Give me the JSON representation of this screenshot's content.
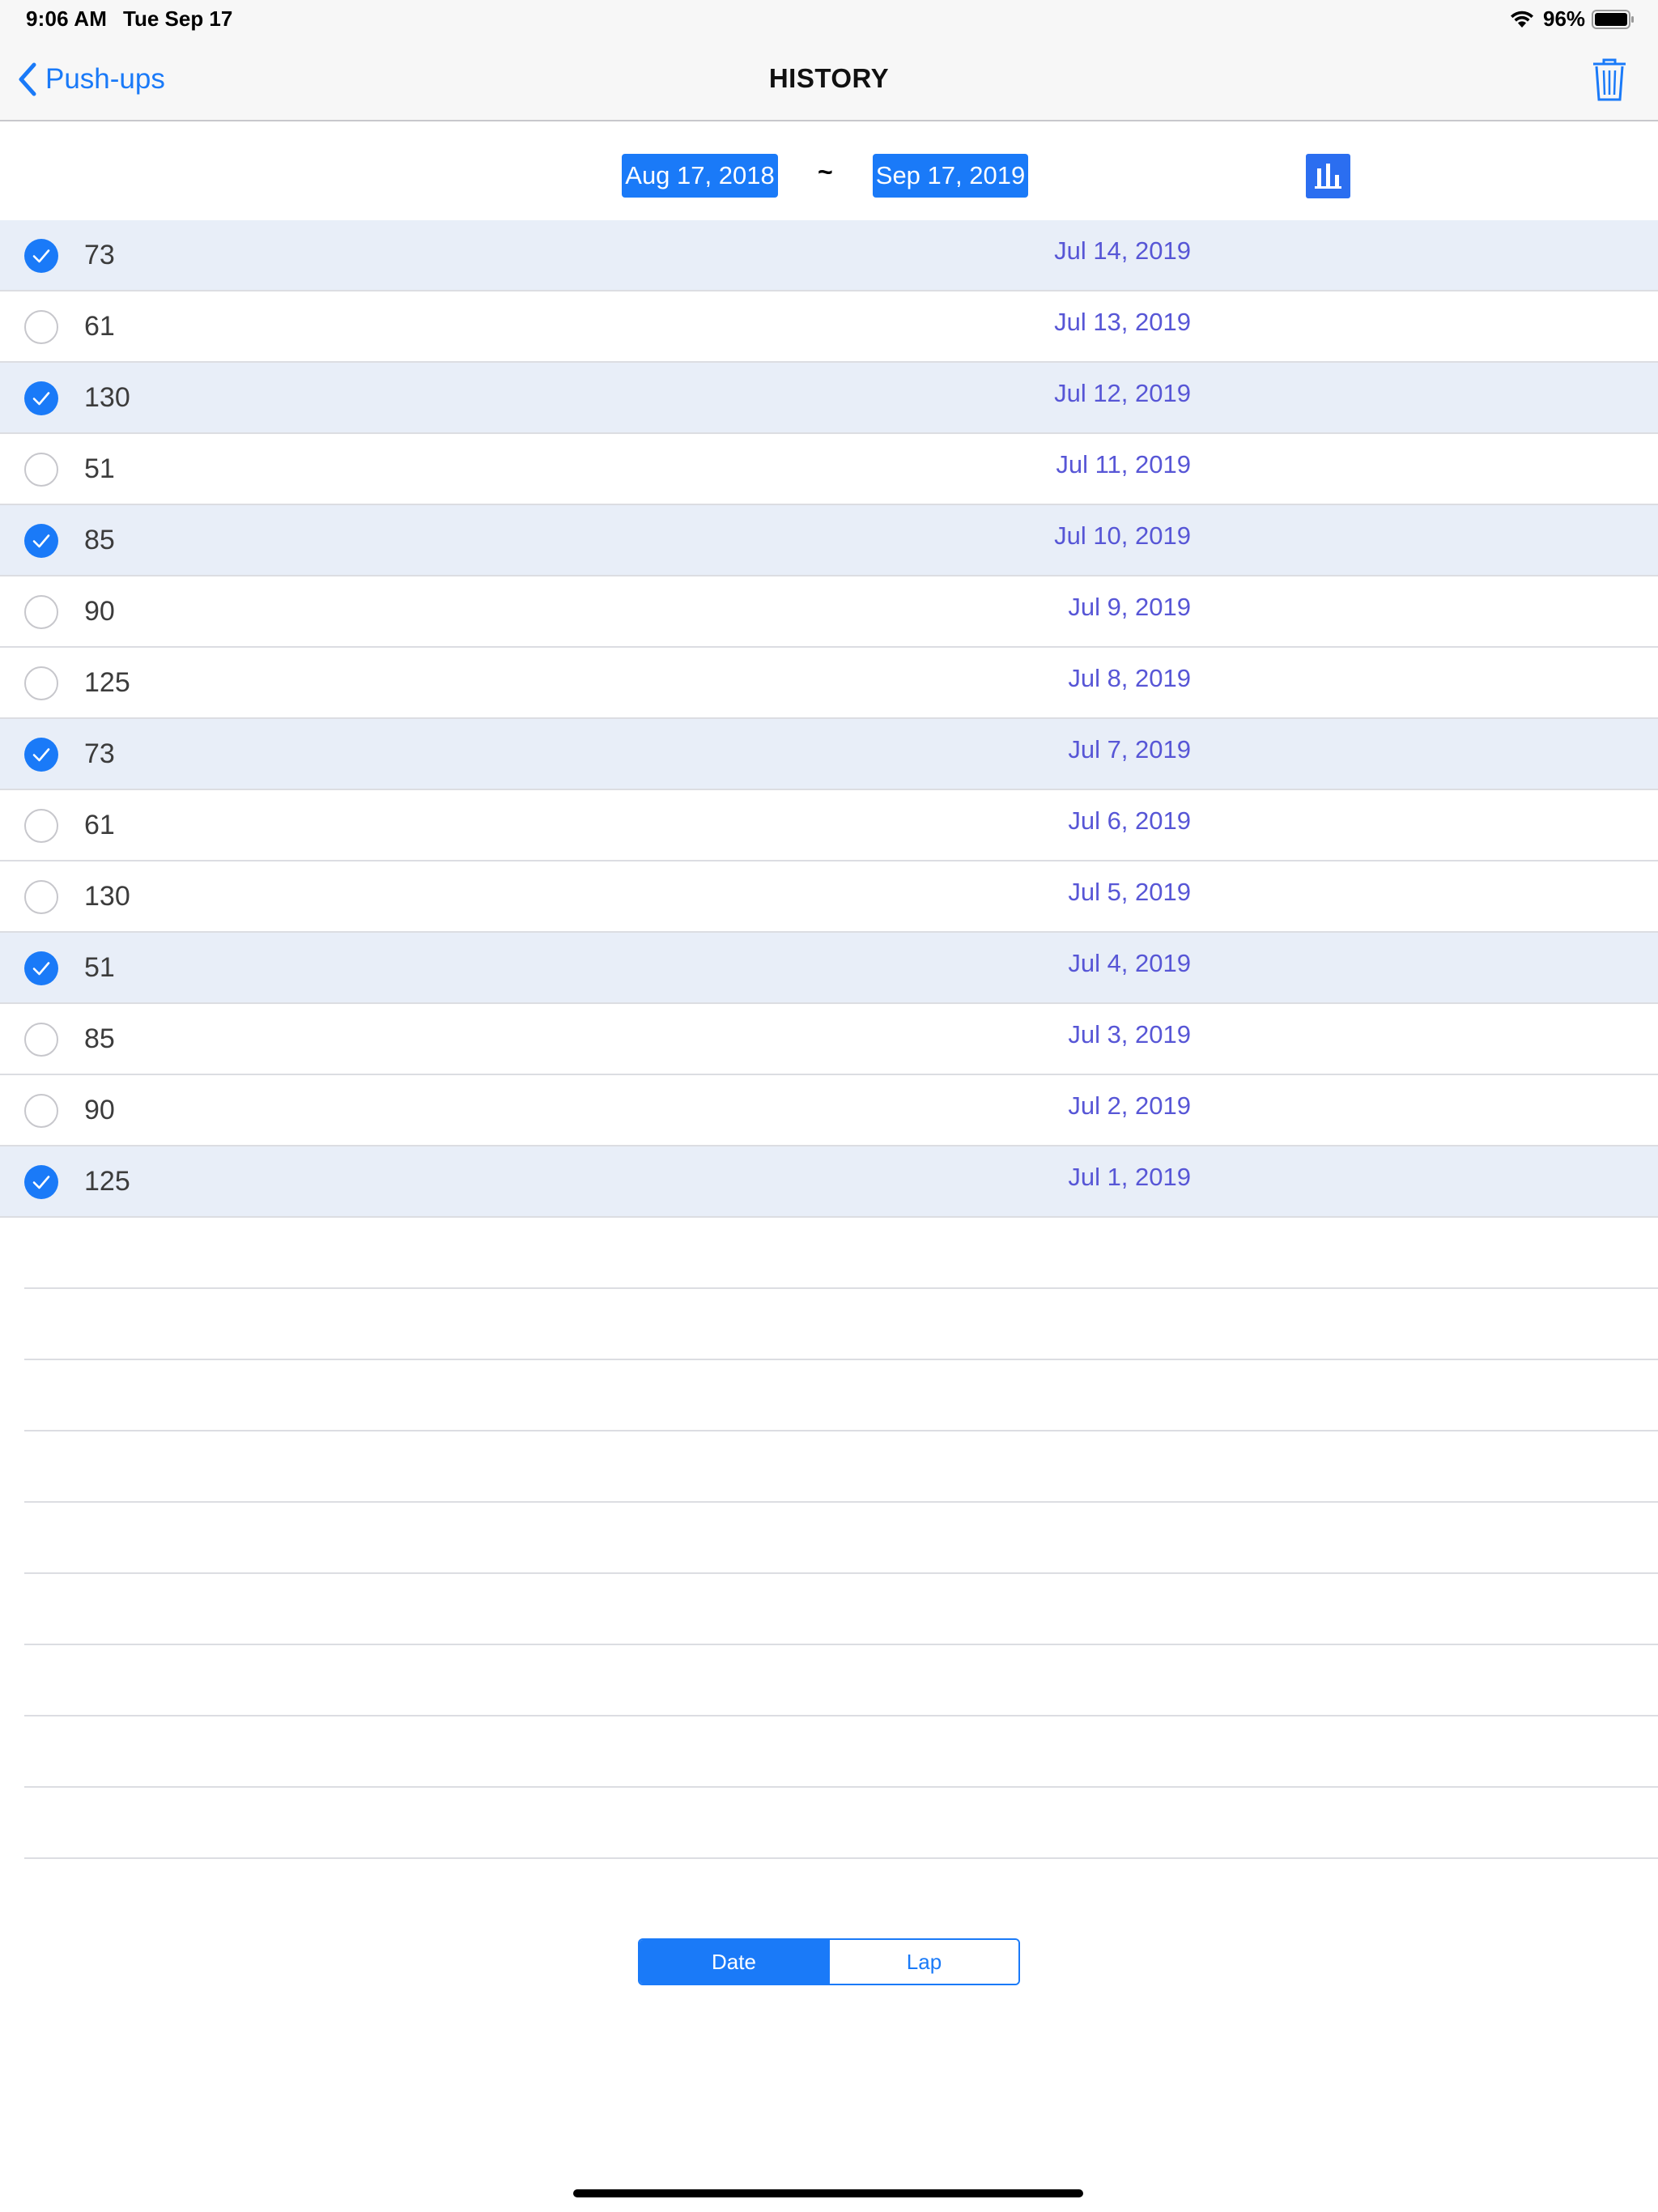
{
  "status_bar": {
    "time": "9:06 AM",
    "date": "Tue Sep 17",
    "battery": "96%"
  },
  "nav": {
    "back_label": "Push-ups",
    "title": "HISTORY",
    "accent": "#1a7af8"
  },
  "date_range": {
    "from": "Aug 17, 2018",
    "separator": "~",
    "to": "Sep 17, 2019"
  },
  "history": [
    {
      "value": "73",
      "date": "Jul 14, 2019",
      "selected": true
    },
    {
      "value": "61",
      "date": "Jul 13, 2019",
      "selected": false
    },
    {
      "value": "130",
      "date": "Jul 12, 2019",
      "selected": true
    },
    {
      "value": "51",
      "date": "Jul 11, 2019",
      "selected": false
    },
    {
      "value": "85",
      "date": "Jul 10, 2019",
      "selected": true
    },
    {
      "value": "90",
      "date": "Jul 9, 2019",
      "selected": false
    },
    {
      "value": "125",
      "date": "Jul 8, 2019",
      "selected": false
    },
    {
      "value": "73",
      "date": "Jul 7, 2019",
      "selected": true
    },
    {
      "value": "61",
      "date": "Jul 6, 2019",
      "selected": false
    },
    {
      "value": "130",
      "date": "Jul 5, 2019",
      "selected": false
    },
    {
      "value": "51",
      "date": "Jul 4, 2019",
      "selected": true
    },
    {
      "value": "85",
      "date": "Jul 3, 2019",
      "selected": false
    },
    {
      "value": "90",
      "date": "Jul 2, 2019",
      "selected": false
    },
    {
      "value": "125",
      "date": "Jul 1, 2019",
      "selected": true
    }
  ],
  "sort": {
    "options": [
      "Date",
      "Lap"
    ],
    "selected": "Date"
  },
  "icons": {
    "back": "chevron-left-icon",
    "trash": "trash-icon",
    "chart": "bar-chart-icon",
    "check": "checkmark-icon",
    "wifi": "wifi-icon",
    "battery": "battery-icon"
  }
}
